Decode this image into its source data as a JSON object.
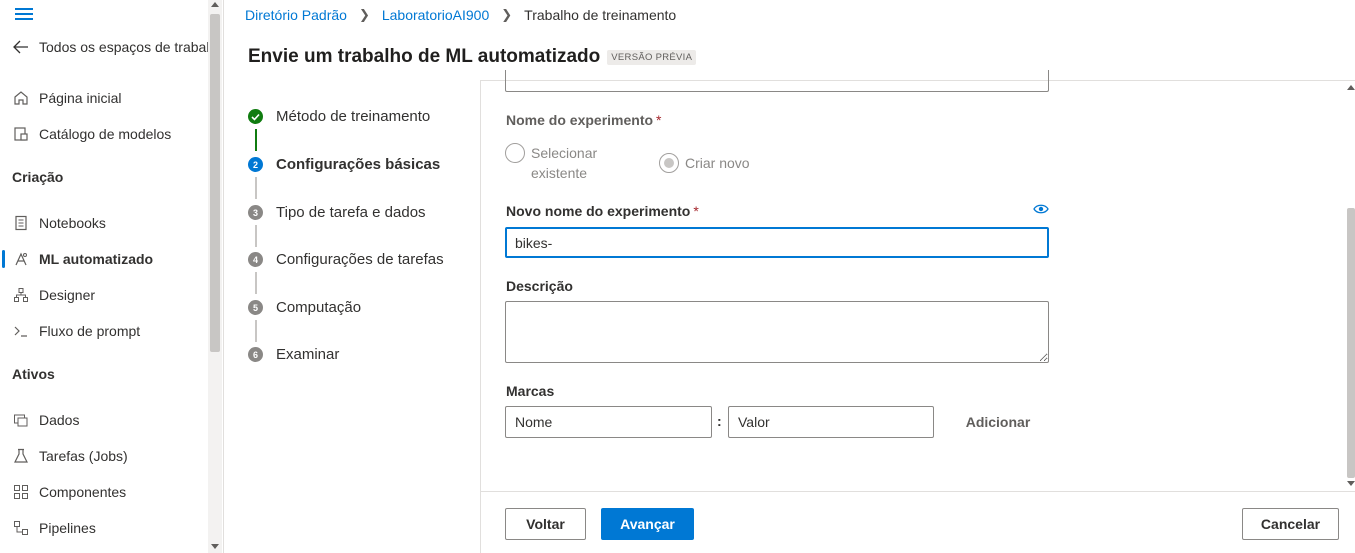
{
  "sidebar": {
    "back_label": "Todos os espaços de trabal",
    "items_top": [
      {
        "label": "Página inicial",
        "icon": "home-icon"
      },
      {
        "label": "Catálogo de modelos",
        "icon": "catalog-icon"
      }
    ],
    "section_creation": "Criação",
    "items_creation": [
      {
        "label": "Notebooks",
        "icon": "notebook-icon"
      },
      {
        "label": "ML automatizado",
        "icon": "automl-icon"
      },
      {
        "label": "Designer",
        "icon": "designer-icon"
      },
      {
        "label": "Fluxo de prompt",
        "icon": "prompt-flow-icon"
      }
    ],
    "section_assets": "Ativos",
    "items_assets": [
      {
        "label": "Dados",
        "icon": "data-icon"
      },
      {
        "label": "Tarefas (Jobs)",
        "icon": "jobs-icon"
      },
      {
        "label": "Componentes",
        "icon": "components-icon"
      },
      {
        "label": "Pipelines",
        "icon": "pipelines-icon"
      }
    ]
  },
  "breadcrumb": {
    "items": [
      "Diretório Padrão",
      "LaboratorioAI900",
      "Trabalho de treinamento"
    ]
  },
  "page": {
    "title": "Envie um trabalho de ML automatizado",
    "badge": "VERSÃO PRÉVIA"
  },
  "steps": [
    {
      "num": "1",
      "label": "Método de treinamento",
      "state": "done"
    },
    {
      "num": "2",
      "label": "Configurações básicas",
      "state": "current"
    },
    {
      "num": "3",
      "label": "Tipo de tarefa e dados",
      "state": "pending"
    },
    {
      "num": "4",
      "label": "Configurações de tarefas",
      "state": "pending"
    },
    {
      "num": "5",
      "label": "Computação",
      "state": "pending"
    },
    {
      "num": "6",
      "label": "Examinar",
      "state": "pending"
    }
  ],
  "form": {
    "experiment_name_label": "Nome do experimento",
    "required_mark": "*",
    "radio_existing": "Selecionar existente",
    "radio_new": "Criar novo",
    "new_experiment_label": "Novo nome do experimento",
    "new_experiment_value": "bikes-",
    "description_label": "Descrição",
    "description_value": "",
    "tags_label": "Marcas",
    "tag_name_placeholder": "Nome",
    "tag_value_placeholder": "Valor",
    "tag_separator": ":",
    "add_label": "Adicionar"
  },
  "footer": {
    "back_label": "Voltar",
    "next_label": "Avançar",
    "cancel_label": "Cancelar"
  },
  "colors": {
    "accent": "#0078d4",
    "success": "#107c10"
  }
}
